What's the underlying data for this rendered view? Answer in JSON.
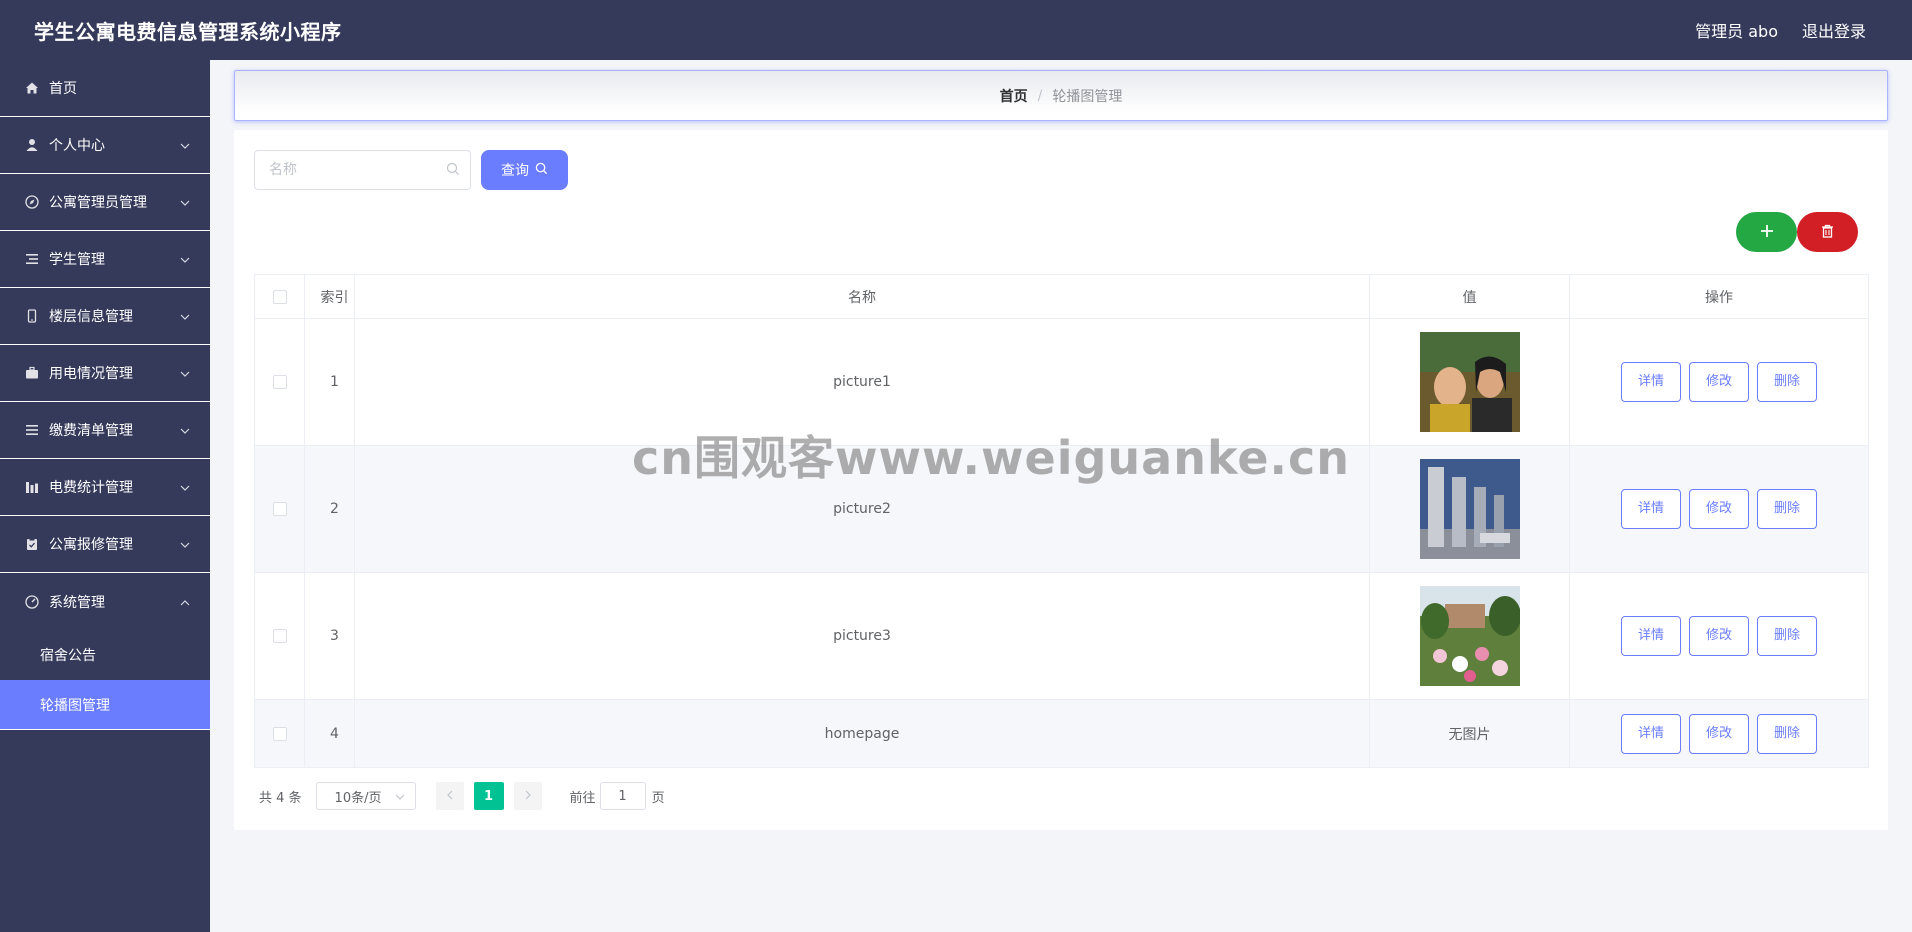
{
  "header": {
    "title": "学生公寓电费信息管理系统小程序",
    "admin_label": "管理员 abo",
    "logout_label": "退出登录"
  },
  "sidebar": {
    "items": [
      {
        "label": "首页",
        "icon": "home-icon",
        "expandable": false
      },
      {
        "label": "个人中心",
        "icon": "user-icon",
        "expandable": true
      },
      {
        "label": "公寓管理员管理",
        "icon": "compass-icon",
        "expandable": true
      },
      {
        "label": "学生管理",
        "icon": "list-icon",
        "expandable": true
      },
      {
        "label": "楼层信息管理",
        "icon": "phone-icon",
        "expandable": true
      },
      {
        "label": "用电情况管理",
        "icon": "briefcase-icon",
        "expandable": true
      },
      {
        "label": "缴费清单管理",
        "icon": "menu-icon",
        "expandable": true
      },
      {
        "label": "电费统计管理",
        "icon": "chart-icon",
        "expandable": true
      },
      {
        "label": "公寓报修管理",
        "icon": "clipboard-icon",
        "expandable": true
      },
      {
        "label": "系统管理",
        "icon": "gauge-icon",
        "expandable": true,
        "expanded": true
      }
    ],
    "sub_items": [
      {
        "label": "宿舍公告",
        "active": false
      },
      {
        "label": "轮播图管理",
        "active": true
      }
    ],
    "active_color": "#6a7dff"
  },
  "breadcrumb": {
    "home": "首页",
    "separator": "/",
    "current": "轮播图管理"
  },
  "search": {
    "placeholder": "名称",
    "value": "",
    "query_label": "查询"
  },
  "table": {
    "headers": {
      "index": "索引",
      "name": "名称",
      "value": "值",
      "actions": "操作"
    },
    "rows": [
      {
        "index": "1",
        "name": "picture1",
        "image": "photo",
        "value_text": ""
      },
      {
        "index": "2",
        "name": "picture2",
        "image": "photo",
        "value_text": ""
      },
      {
        "index": "3",
        "name": "picture3",
        "image": "photo",
        "value_text": ""
      },
      {
        "index": "4",
        "name": "homepage",
        "image": "",
        "value_text": "无图片"
      }
    ],
    "action_labels": {
      "detail": "详情",
      "edit": "修改",
      "delete": "删除"
    }
  },
  "pagination": {
    "total": "共 4 条",
    "page_size": "10条/页",
    "current_page": "1",
    "goto_label": "前往",
    "goto_value": "1",
    "page_suffix": "页"
  },
  "watermark": "cn围观客www.weiguanke.cn",
  "colors": {
    "primary": "#6a7dff",
    "nav_bg": "#353a5b",
    "add": "#23a844",
    "delete": "#d21f25",
    "page_active": "#00c292"
  }
}
